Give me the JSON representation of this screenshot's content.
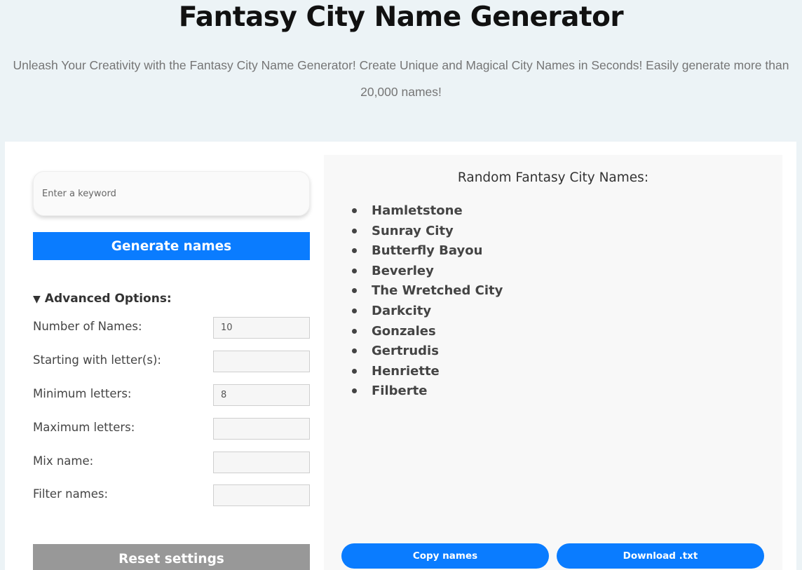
{
  "header": {
    "title": "Fantasy City Name Generator",
    "subtitle": "Unleash Your Creativity with the Fantasy City Name Generator! Create Unique and Magical City Names in Seconds! Easily generate more than 20,000 names!"
  },
  "form": {
    "keyword_placeholder": "Enter a keyword",
    "generate_label": "Generate names",
    "advanced_label": "Advanced Options:",
    "options": [
      {
        "label": "Number of Names:",
        "value": "10"
      },
      {
        "label": "Starting with letter(s):",
        "value": ""
      },
      {
        "label": "Minimum letters:",
        "value": "8"
      },
      {
        "label": "Maximum letters:",
        "value": ""
      },
      {
        "label": "Mix name:",
        "value": ""
      },
      {
        "label": "Filter names:",
        "value": ""
      }
    ],
    "reset_label": "Reset settings"
  },
  "results": {
    "title": "Random Fantasy City Names:",
    "names": [
      "Hamletstone",
      "Sunray City",
      "Butterfly Bayou",
      "Beverley",
      "The Wretched City",
      "Darkcity",
      "Gonzales",
      "Gertrudis",
      "Henriette",
      "Filberte"
    ],
    "copy_label": "Copy names",
    "download_label": "Download .txt"
  },
  "colors": {
    "accent": "#0a7cff",
    "background": "#ecf3f6",
    "reset": "#989898"
  }
}
